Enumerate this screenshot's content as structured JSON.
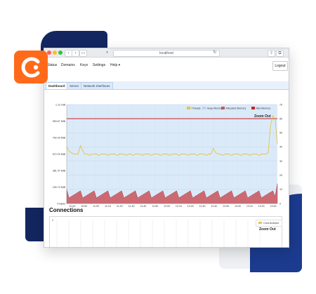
{
  "browser": {
    "url": "localhost",
    "back_icon": "chevron-left-icon",
    "forward_icon": "chevron-right-icon"
  },
  "nav": {
    "items": [
      "Status",
      "Domains",
      "Keys",
      "Settings",
      "Help ▾"
    ],
    "logout": "Logout"
  },
  "tabs": [
    {
      "label": "Dashboard",
      "active": true
    },
    {
      "label": "Server",
      "active": false
    },
    {
      "label": "Network Interfaces",
      "active": false
    }
  ],
  "colors": {
    "accent_orange": "#ff6a1a",
    "brand_navy": "#132660",
    "threads": "#e3c34a",
    "heap": "#cfe3f7",
    "allocated": "#c9545c",
    "max": "#cc1f1f"
  },
  "chart_data": {
    "type": "line",
    "y_left_ticks": [
      "1.12 GiB",
      "953.67 MiB",
      "762.94 MiB",
      "572.20 MiB",
      "381.47 MiB",
      "190.73 MiB",
      "0 bytes"
    ],
    "y_right_ticks": [
      "70",
      "60",
      "50",
      "40",
      "30",
      "20",
      "10",
      "0"
    ],
    "x_ticks": [
      "10:40",
      "10:50",
      "11:00",
      "11:10",
      "11:20",
      "11:30",
      "11:40",
      "11:50",
      "12:00",
      "12:10",
      "12:20",
      "12:30",
      "12:40",
      "12:50",
      "13:00",
      "13:10",
      "13:20",
      "13:30"
    ],
    "legend": [
      "Threads",
      "Heap Memory",
      "Allocated Memory",
      "Max Memory"
    ],
    "zoom_label": "Zoom Out",
    "left_range": [
      0,
      1.12
    ],
    "right_range": [
      0,
      70
    ],
    "max_memory_threads": 60,
    "threads": [
      40,
      37,
      36,
      35,
      35,
      35,
      41,
      37,
      35,
      35,
      34,
      35,
      35,
      35,
      34,
      35,
      35,
      35,
      34,
      35,
      35,
      35,
      34,
      35,
      35,
      35,
      34,
      35,
      35,
      34,
      35,
      35,
      35,
      34,
      35,
      35,
      35,
      34,
      35,
      35,
      35,
      34,
      35,
      35,
      35,
      34,
      35,
      35,
      35,
      34,
      35,
      35,
      35,
      34,
      35,
      35,
      35,
      34,
      35,
      35,
      35,
      34,
      35,
      35,
      39,
      36,
      35,
      35,
      34,
      35,
      35,
      35,
      34,
      35,
      35,
      35,
      34,
      35,
      35,
      35,
      34,
      35,
      35,
      35,
      34,
      35,
      35,
      35,
      36,
      55,
      62,
      60,
      42
    ],
    "allocated": [
      10,
      4,
      5,
      6,
      7,
      8,
      9,
      4,
      5,
      6,
      7,
      8,
      9,
      4,
      5,
      6,
      7,
      8,
      9,
      4,
      5,
      6,
      7,
      8,
      9,
      4,
      5,
      6,
      7,
      8,
      9,
      4,
      5,
      6,
      7,
      8,
      9,
      4,
      5,
      6,
      7,
      8,
      9,
      4,
      5,
      6,
      7,
      8,
      9,
      4,
      5,
      6,
      7,
      8,
      9,
      4,
      5,
      6,
      7,
      8,
      9,
      4,
      5,
      6,
      7,
      8,
      9,
      4,
      5,
      6,
      7,
      8,
      9,
      4,
      5,
      6,
      7,
      8,
      9,
      4,
      5,
      6,
      7,
      8,
      9,
      4,
      5,
      6,
      7,
      8,
      9,
      5,
      14
    ]
  },
  "connections": {
    "title": "Connections",
    "y_tick": "1",
    "legend": "Connections",
    "zoom_label": "Zoom Out"
  }
}
